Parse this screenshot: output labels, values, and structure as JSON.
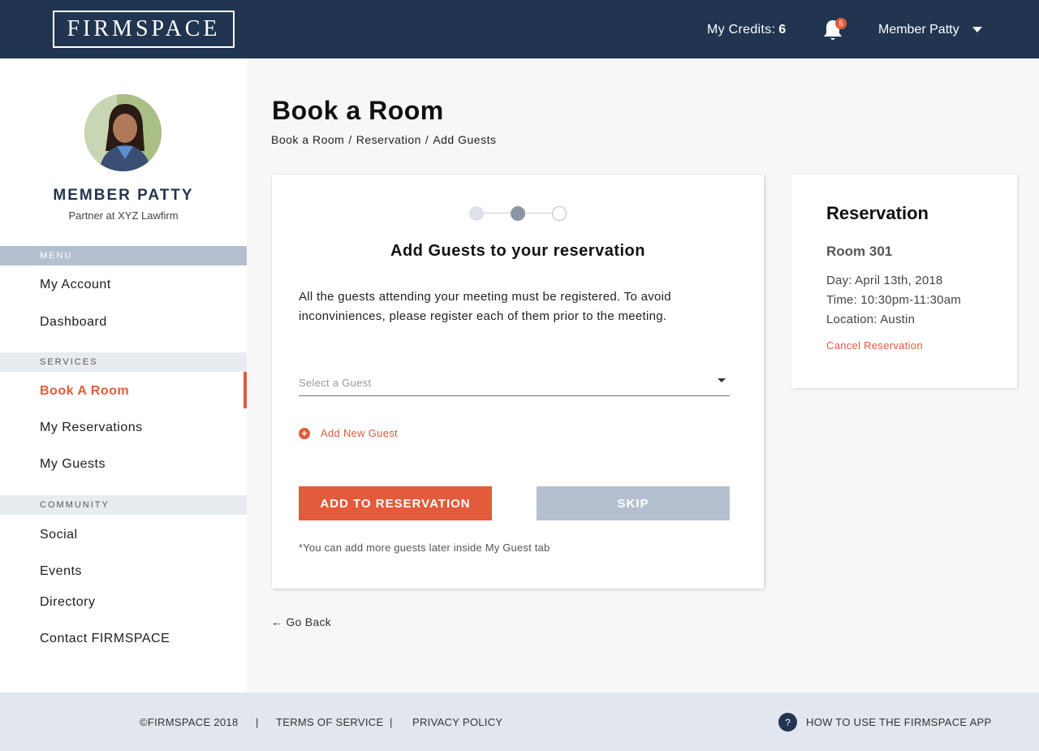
{
  "header": {
    "logo_text": "FIRMSPACE",
    "credits_label": "My Credits:",
    "credits_value": "6",
    "notification_count": "5",
    "user_name": "Member Patty"
  },
  "sidebar": {
    "profile": {
      "name": "MEMBER PATTY",
      "role": "Partner at XYZ Lawfirm"
    },
    "sections": [
      {
        "label": "MENU",
        "items": [
          "My Account",
          "Dashboard"
        ]
      },
      {
        "label": "SERVICES",
        "items": [
          "Book A Room",
          "My Reservations",
          "My Guests"
        ]
      },
      {
        "label": "COMMUNITY",
        "items": [
          "Social",
          "Events",
          "Directory",
          "Contact FIRMSPACE"
        ]
      }
    ],
    "active_item": "Book A Room"
  },
  "page": {
    "title": "Book a Room",
    "breadcrumb": [
      "Book a Room",
      "Reservation",
      "Add Guests"
    ],
    "breadcrumb_separator": "/"
  },
  "guest_card": {
    "steps_total": 3,
    "current_step": 2,
    "title": "Add Guests to your reservation",
    "description": "All the guests attending your meeting must be registered. To avoid inconviniences, please register each of them prior to the meeting.",
    "select_placeholder": "Select a Guest",
    "add_new_label": "Add New Guest",
    "primary_button": "ADD TO RESERVATION",
    "secondary_button": "SKIP",
    "note": "*You can add more guests later inside My Guest tab"
  },
  "go_back_label": "Go Back",
  "reservation": {
    "title": "Reservation",
    "room": "Room 301",
    "day": "Day: April 13th, 2018",
    "time": "Time: 10:30pm-11:30am",
    "location": "Location: Austin",
    "cancel_label": "Cancel Reservation"
  },
  "footer": {
    "copyright": "©FIRMSPACE 2018",
    "separator": "|",
    "terms": "TERMS OF SERVICE",
    "privacy": "PRIVACY POLICY",
    "help_label": "HOW TO USE THE FIRMSPACE APP"
  },
  "colors": {
    "brand_navy": "#213550",
    "accent_orange": "#e25b3a",
    "muted_blue": "#b4c0d0"
  },
  "icons": [
    "bell-icon",
    "chevron-down-icon",
    "plus-circle-icon",
    "arrow-left-icon",
    "help-circle-icon"
  ]
}
